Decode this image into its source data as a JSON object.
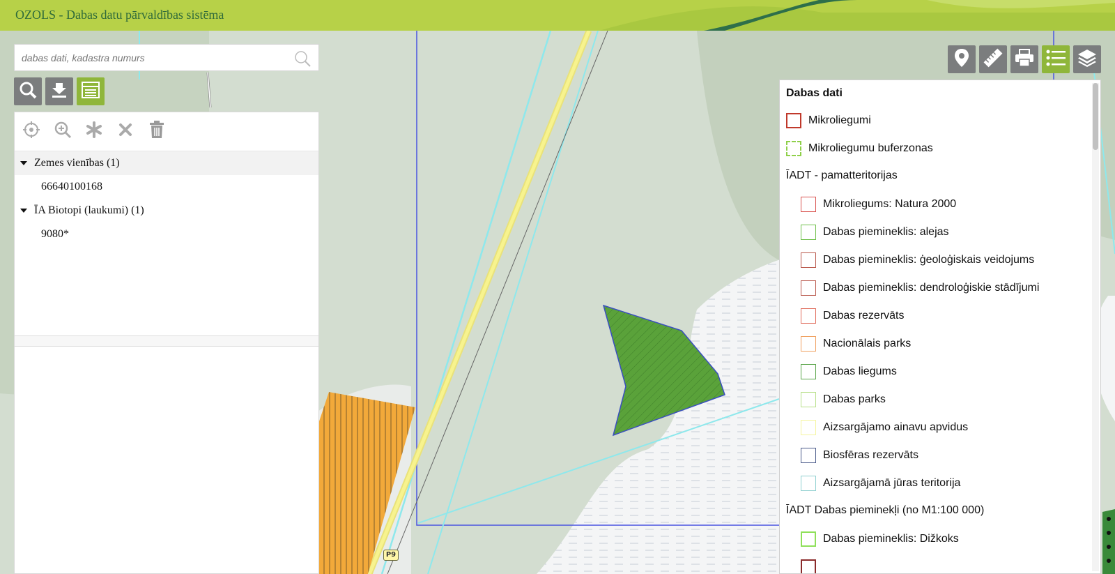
{
  "app": {
    "title": "OZOLS - Dabas datu pārvaldības sistēma"
  },
  "search": {
    "placeholder": "dabas dati, kadastra numurs"
  },
  "map": {
    "road_label": "P9"
  },
  "tree": {
    "groups": [
      {
        "label": "Zemes vienības (1)",
        "items": [
          "66640100168"
        ]
      },
      {
        "label": "ĪA Biotopi (laukumi) (1)",
        "items": [
          "9080*"
        ]
      }
    ]
  },
  "legend": {
    "title": "Dabas dati",
    "top_items": [
      {
        "label": "Mikroliegumi",
        "color": "#c0392b"
      },
      {
        "label": "Mikroliegumu buferzonas",
        "color": "#8fd04a"
      }
    ],
    "section1": "ĪADT - pamatteritorijas",
    "section1_items": [
      {
        "label": "Mikroliegums: Natura 2000",
        "color": "#d9534f"
      },
      {
        "label": "Dabas piemineklis: alejas",
        "color": "#6fbf4a"
      },
      {
        "label": "Dabas piemineklis: ģeoloģiskais veidojums",
        "color": "#b8564a"
      },
      {
        "label": "Dabas piemineklis: dendroloģiskie stādījumi",
        "color": "#b8564a"
      },
      {
        "label": "Dabas rezervāts",
        "color": "#e06b5a"
      },
      {
        "label": "Nacionālais parks",
        "color": "#f0a060"
      },
      {
        "label": "Dabas liegums",
        "color": "#5aa54a"
      },
      {
        "label": "Dabas parks",
        "color": "#b8e08a"
      },
      {
        "label": "Aizsargājamo ainavu apvidus",
        "color": "#f5f5a0"
      },
      {
        "label": "Biosfēras rezervāts",
        "color": "#4a5a8a"
      },
      {
        "label": "Aizsargājamā jūras teritorija",
        "color": "#8fd0d0"
      }
    ],
    "section2": "ĪADT Dabas pieminekļi (no M1:100 000)",
    "section2_items": [
      {
        "label": "Dabas piemineklis: Dižkoks",
        "color": "#8fe05a"
      }
    ]
  }
}
